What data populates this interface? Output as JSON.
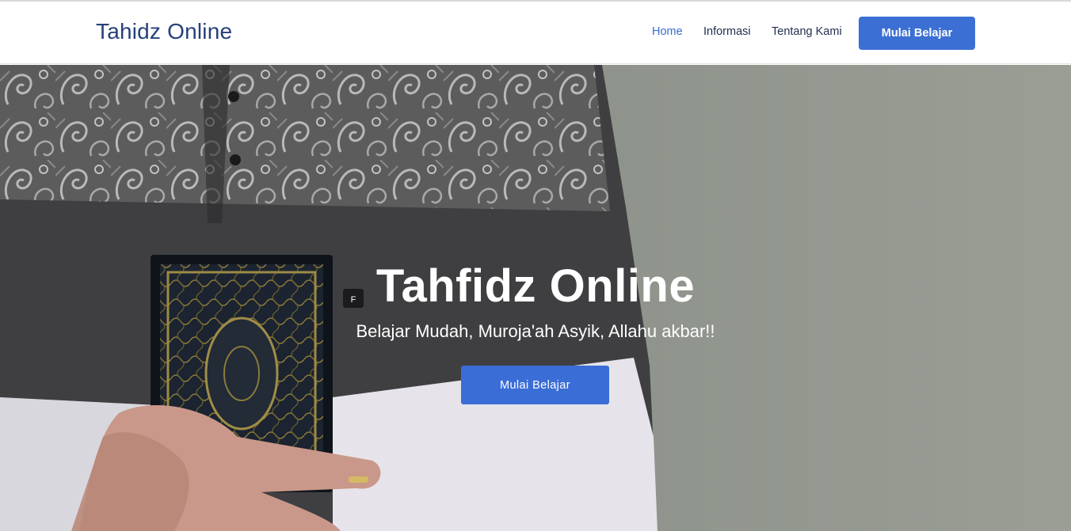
{
  "navbar": {
    "brand": "Tahidz Online",
    "links": [
      {
        "label": "Home",
        "active": true
      },
      {
        "label": "Informasi",
        "active": false
      },
      {
        "label": "Tentang Kami",
        "active": false
      }
    ],
    "cta_label": "Mulai Belajar"
  },
  "hero": {
    "title": "Tahfidz Online",
    "subtitle": "Belajar Mudah, Muroja'ah Asyik, Allahu akbar!!",
    "cta_label": "Mulai Belajar",
    "background_image": "man-in-batik-shirt-holding-quran-photo"
  },
  "colors": {
    "brand": "#27407a",
    "accent": "#3c6fd3",
    "active_link": "#3a6cd1",
    "nav_text": "#1f2d4d"
  }
}
